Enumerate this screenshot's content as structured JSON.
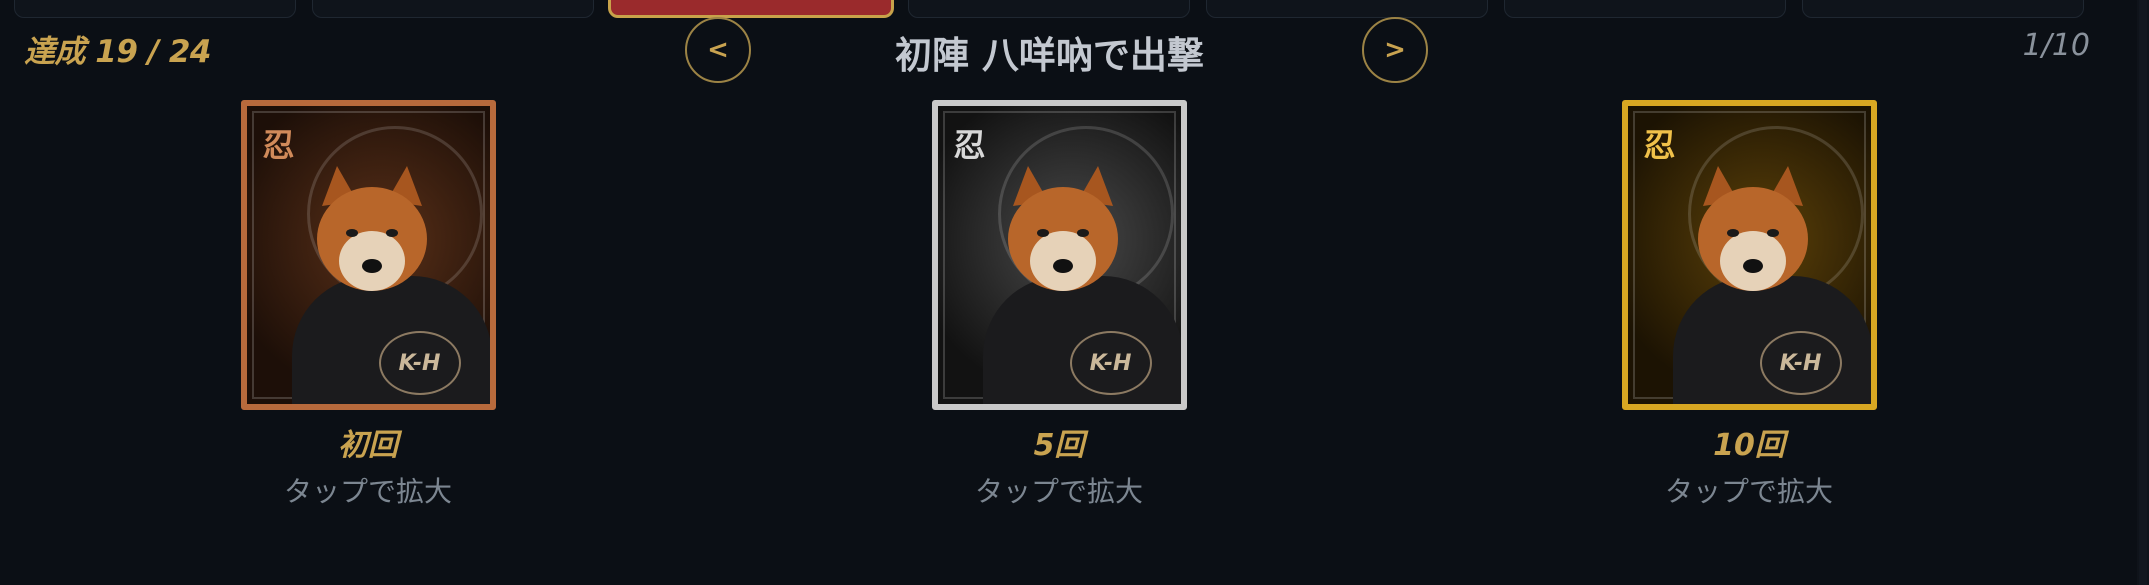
{
  "header": {
    "achieved": "達成 19 / 24",
    "title": "初陣 八咩吶で出撃",
    "counter": "1/10",
    "prev_label": "<",
    "next_label": ">"
  },
  "colors": {
    "accent": "#c9a350",
    "active_tab": "#9a2a2c",
    "bronze": "#b86a3c",
    "silver": "#c9c9c9",
    "gold": "#d8a722"
  },
  "cards": [
    {
      "tier": "bronze",
      "label": "初回",
      "hint": "タップで拡大",
      "kanji": "忍",
      "emblem": "K-H"
    },
    {
      "tier": "silver",
      "label": "5回",
      "hint": "タップで拡大",
      "kanji": "忍",
      "emblem": "K-H"
    },
    {
      "tier": "gold",
      "label": "10回",
      "hint": "タップで拡大",
      "kanji": "忍",
      "emblem": "K-H"
    }
  ]
}
